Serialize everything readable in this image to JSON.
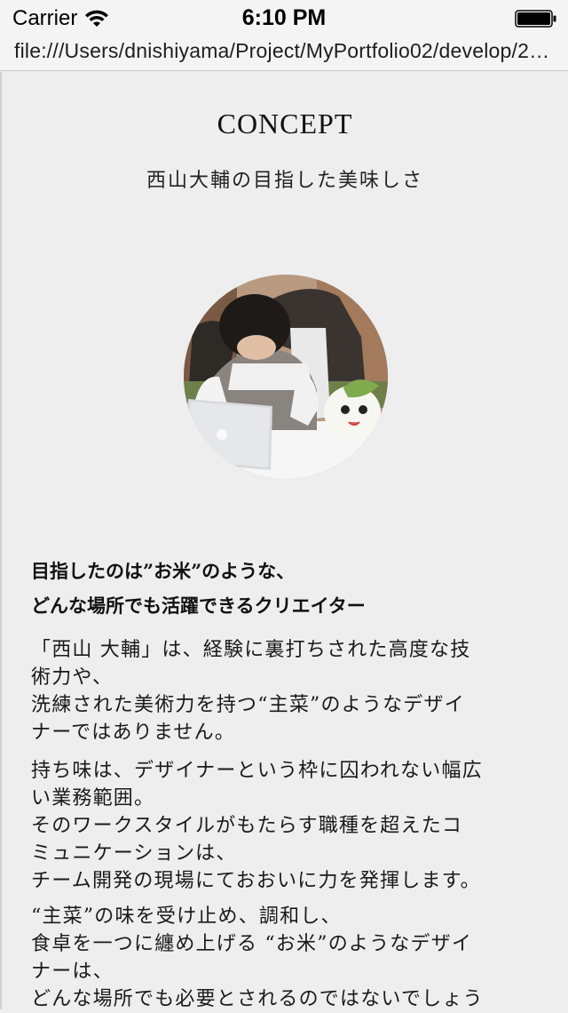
{
  "status_bar": {
    "carrier": "Carrier",
    "time": "6:10 PM"
  },
  "browser": {
    "url": "file:///Users/dnishiyama/Project/MyPortfolio02/develop/2…"
  },
  "concept": {
    "title": "CONCEPT",
    "subtitle": "西山大輔の目指した美味しさ",
    "lead_lines": [
      "目指したのは”お米”のような、",
      "どんな場所でも活躍できるクリエイター"
    ],
    "paragraphs": [
      {
        "lines": [
          "「西山 大輔」は、経験に裏打ちされた高度な技",
          "術力や、",
          "洗練された美術力を持つ“主菜”のようなデザイ",
          "ナーではありません。"
        ]
      },
      {
        "lines": [
          "持ち味は、デザイナーという枠に囚われない幅広",
          "い業務範囲。",
          "そのワークスタイルがもたらす職種を超えたコ",
          "ミュニケーションは、",
          "チーム開発の現場にておおいに力を発揮します。"
        ]
      },
      {
        "lines": [
          "“主菜”の味を受け止め、調和し、",
          "食卓を一つに纏め上げる “お米”のようなデザイ",
          "ナーは、",
          "どんな場所でも必要とされるのではないでしょう"
        ]
      }
    ]
  },
  "icons": {
    "wifi": "wifi-icon",
    "battery": "battery-icon"
  }
}
